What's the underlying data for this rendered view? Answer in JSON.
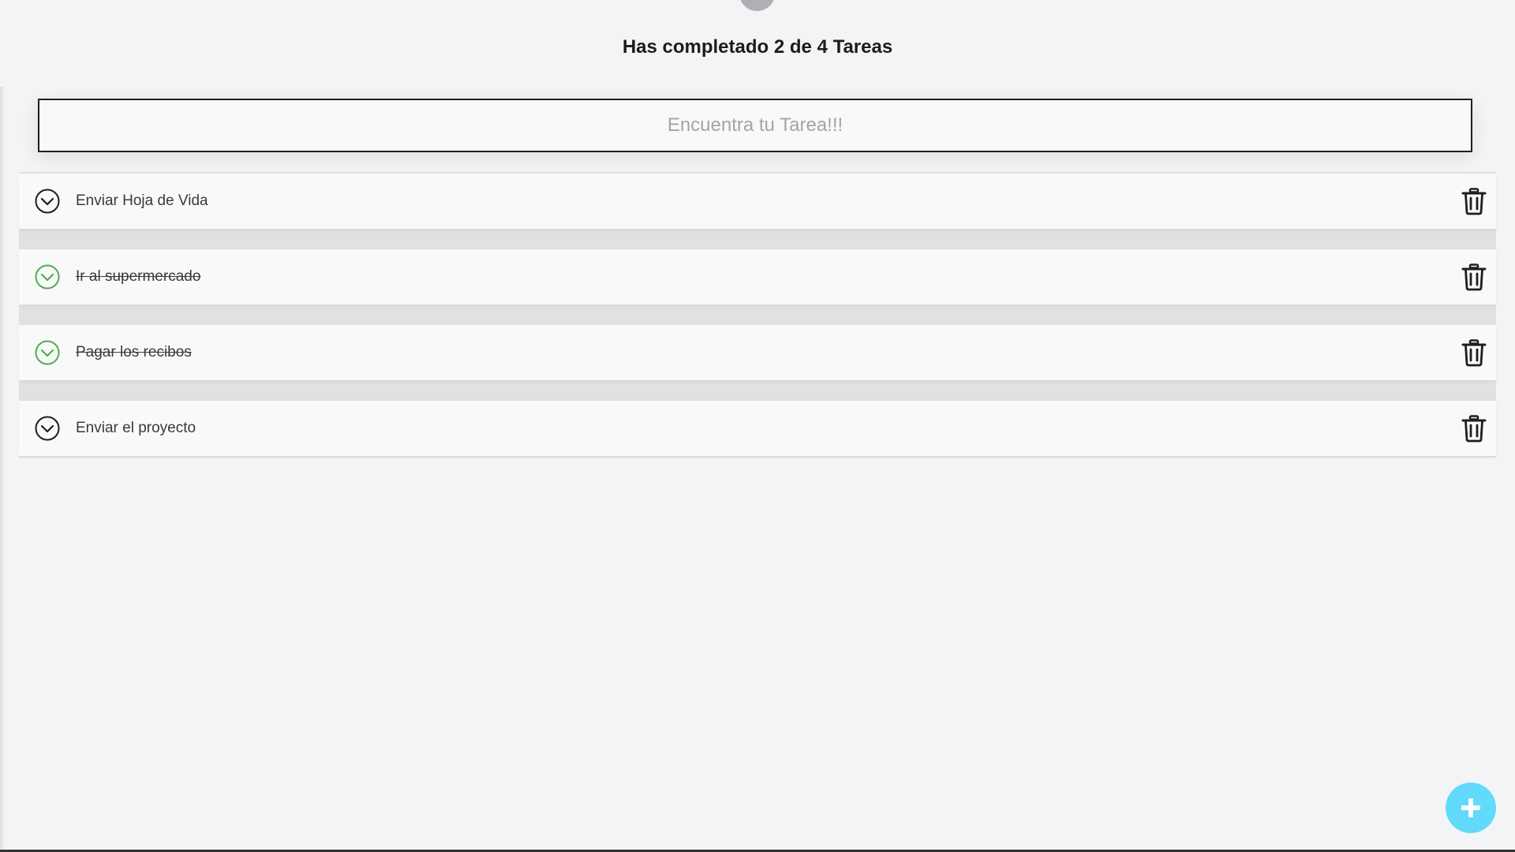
{
  "header": {
    "title": "Has completado 2 de 4 Tareas"
  },
  "search": {
    "placeholder": "Encuentra tu Tarea!!!",
    "value": ""
  },
  "todos": [
    {
      "text": "Enviar Hoja de Vida",
      "completed": false
    },
    {
      "text": "Ir al supermercado",
      "completed": true
    },
    {
      "text": "Pagar los recibos",
      "completed": true
    },
    {
      "text": "Enviar el proyecto",
      "completed": false
    }
  ],
  "icons": {
    "check": "check-circle-icon",
    "delete": "trash-icon",
    "add": "plus-icon"
  },
  "colors": {
    "background": "#f3f4f6",
    "completed_check": "#4caf50",
    "pending_check": "#1e1e1e",
    "fab": "#61dafb",
    "fab_icon": "#ffffff"
  }
}
